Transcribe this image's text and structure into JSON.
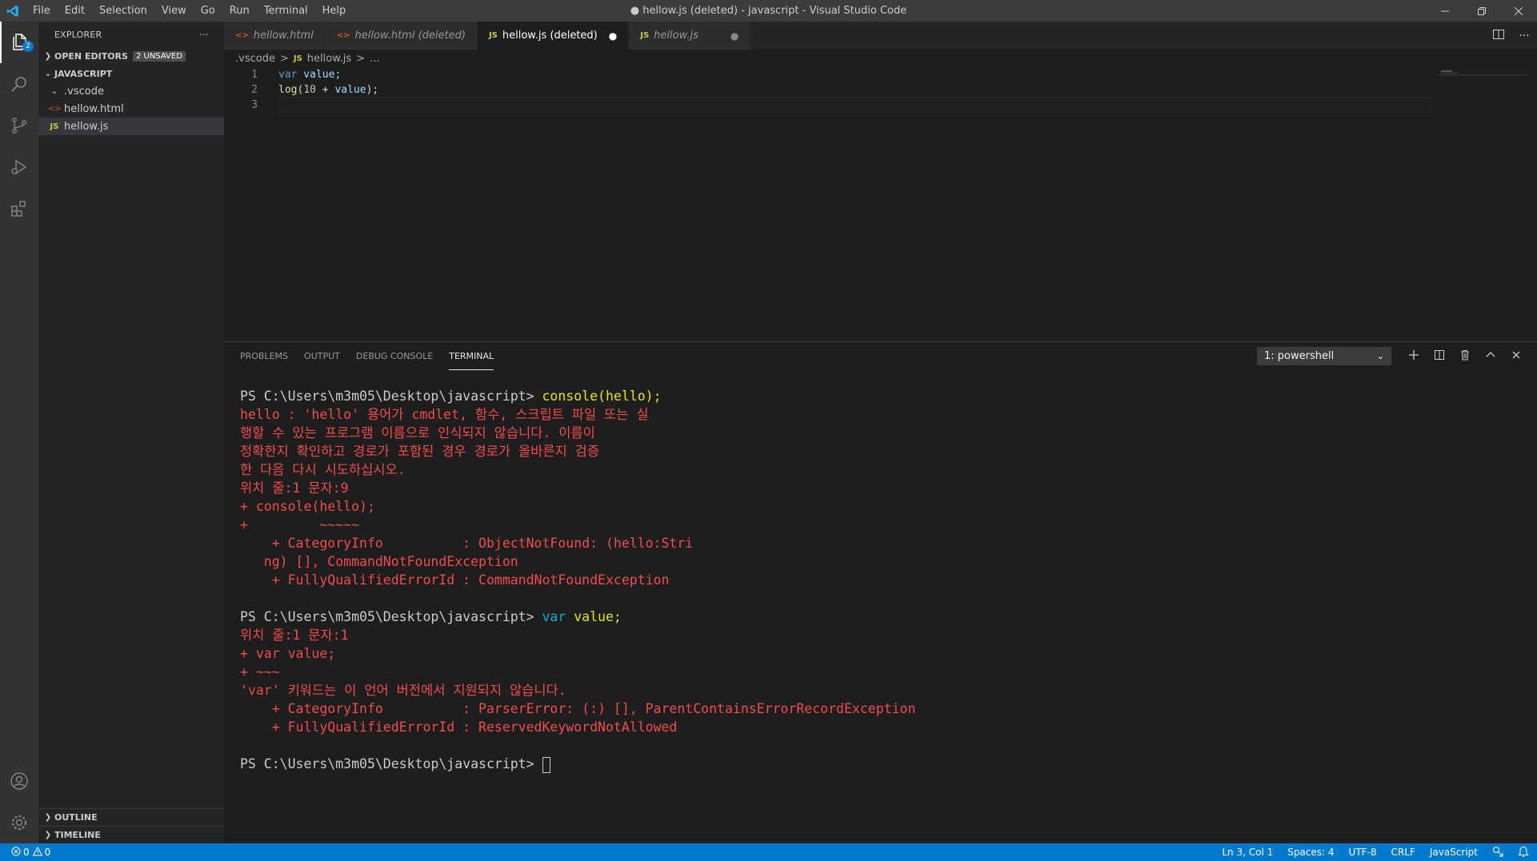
{
  "titlebar": {
    "menu": [
      "File",
      "Edit",
      "Selection",
      "View",
      "Go",
      "Run",
      "Terminal",
      "Help"
    ],
    "title": "● hellow.js (deleted) - javascript - Visual Studio Code"
  },
  "activity": {
    "explorer_badge": "2"
  },
  "sidebar": {
    "title": "EXPLORER",
    "more": "···",
    "open_editors": "OPEN EDITORS",
    "unsaved_badge": "2 UNSAVED",
    "folder": "JAVASCRIPT",
    "items": [
      {
        "label": ".vscode",
        "icon": "⌄"
      },
      {
        "label": "hellow.html",
        "icon": "<>"
      },
      {
        "label": "hellow.js",
        "icon": "JS"
      }
    ],
    "outline": "OUTLINE",
    "timeline": "TIMELINE"
  },
  "tabs": [
    {
      "label": "hellow.html",
      "icon": "<>"
    },
    {
      "label": "hellow.html (deleted)",
      "icon": "<>"
    },
    {
      "label": "hellow.js (deleted)",
      "icon": "JS",
      "dot": "●"
    },
    {
      "label": "hellow.js",
      "icon": "JS",
      "dot": "●"
    }
  ],
  "breadcrumb": {
    "folder": ".vscode",
    "sep": ">",
    "file_icon": "JS",
    "file": "hellow.js",
    "tail": "..."
  },
  "code": {
    "lines": [
      "1",
      "2",
      "3"
    ],
    "l1": {
      "kw": "var",
      "rest": " value;"
    },
    "l2": {
      "fn": "log",
      "open": "(",
      "num": "10",
      "op": " + ",
      "id": "value",
      "close": ");"
    }
  },
  "panel": {
    "tabs": [
      "PROBLEMS",
      "OUTPUT",
      "DEBUG CONSOLE",
      "TERMINAL"
    ],
    "select": "1: powershell"
  },
  "terminal": {
    "prompt": "PS C:\\Users\\m3m05\\Desktop\\javascript> ",
    "cmd1": "console(hello);",
    "err1": [
      "hello : 'hello' 용어가 cmdlet, 함수, 스크립트 파일 또는 실",
      "행할 수 있는 프로그램 이름으로 인식되지 않습니다. 이름이",
      "정확한지 확인하고 경로가 포함된 경우 경로가 올바른지 검증",
      "한 다음 다시 시도하십시오.",
      "위치 줄:1 문자:9",
      "+ console(hello);",
      "+         ~~~~~",
      "    + CategoryInfo          : ObjectNotFound: (hello:Stri",
      "   ng) [], CommandNotFoundException",
      "    + FullyQualifiedErrorId : CommandNotFoundException"
    ],
    "cmd2_kw": "var",
    "cmd2_rest": " value;",
    "err2": [
      "위치 줄:1 문자:1",
      "+ var value;",
      "+ ~~~",
      "'var' 키워드는 이 언어 버전에서 지원되지 않습니다.",
      "    + CategoryInfo          : ParserError: (:) [], ParentContainsErrorRecordException",
      "    + FullyQualifiedErrorId : ReservedKeywordNotAllowed"
    ]
  },
  "status": {
    "errors": "0",
    "warnings": "0",
    "position": "Ln 3, Col 1",
    "spaces": "Spaces: 4",
    "encoding": "UTF-8",
    "eol": "CRLF",
    "language": "JavaScript"
  }
}
